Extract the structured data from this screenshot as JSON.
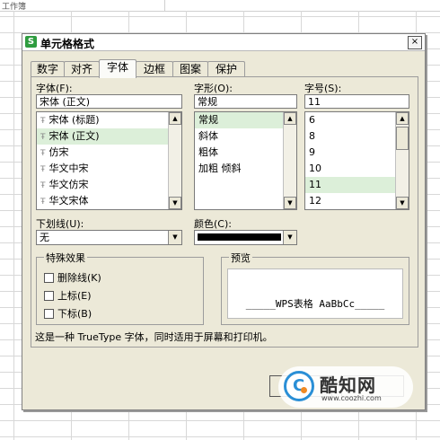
{
  "spreadsheet": {
    "cell_ref": "工作簿"
  },
  "dialog": {
    "title": "单元格格式",
    "app_icon": "S",
    "close_glyph": "×",
    "tabs": [
      {
        "label": "数字"
      },
      {
        "label": "对齐"
      },
      {
        "label": "字体",
        "active": true
      },
      {
        "label": "边框"
      },
      {
        "label": "图案"
      },
      {
        "label": "保护"
      }
    ],
    "font": {
      "label": "字体(F):",
      "value": "宋体 (正文)",
      "items": [
        "宋体 (标题)",
        "宋体 (正文)",
        "仿宋",
        "华文中宋",
        "华文仿宋",
        "华文宋体"
      ],
      "selected_index": 1,
      "tt_glyph": "Ŧ"
    },
    "style": {
      "label": "字形(O):",
      "value": "常规",
      "items": [
        "常规",
        "斜体",
        "粗体",
        "加粗 倾斜"
      ],
      "selected_index": 0
    },
    "size": {
      "label": "字号(S):",
      "value": "11",
      "items": [
        "6",
        "8",
        "9",
        "10",
        "11",
        "12"
      ],
      "selected_index": 4
    },
    "underline": {
      "label": "下划线(U):",
      "value": "无"
    },
    "color": {
      "label": "颜色(C):",
      "value_color": "#000000"
    },
    "effects": {
      "title": "特殊效果",
      "strikethrough": "删除线(K)",
      "superscript": "上标(E)",
      "subscript": "下标(B)"
    },
    "preview": {
      "title": "预览",
      "text": "_____WPS表格  AaBbCc_____"
    },
    "note": "这是一种 TrueType 字体，同时适用于屏幕和打印机。"
  },
  "watermark": {
    "title": "酷知网",
    "url": "www.coozhi.com"
  },
  "icons": {
    "scroll_up": "▲",
    "scroll_down": "▼",
    "combo_arrow": "▼"
  },
  "colors": {
    "selection": "#dcefd9",
    "dialog_bg": "#ece9d8",
    "logo_blue": "#2a8fd6",
    "logo_orange": "#f08a24"
  }
}
